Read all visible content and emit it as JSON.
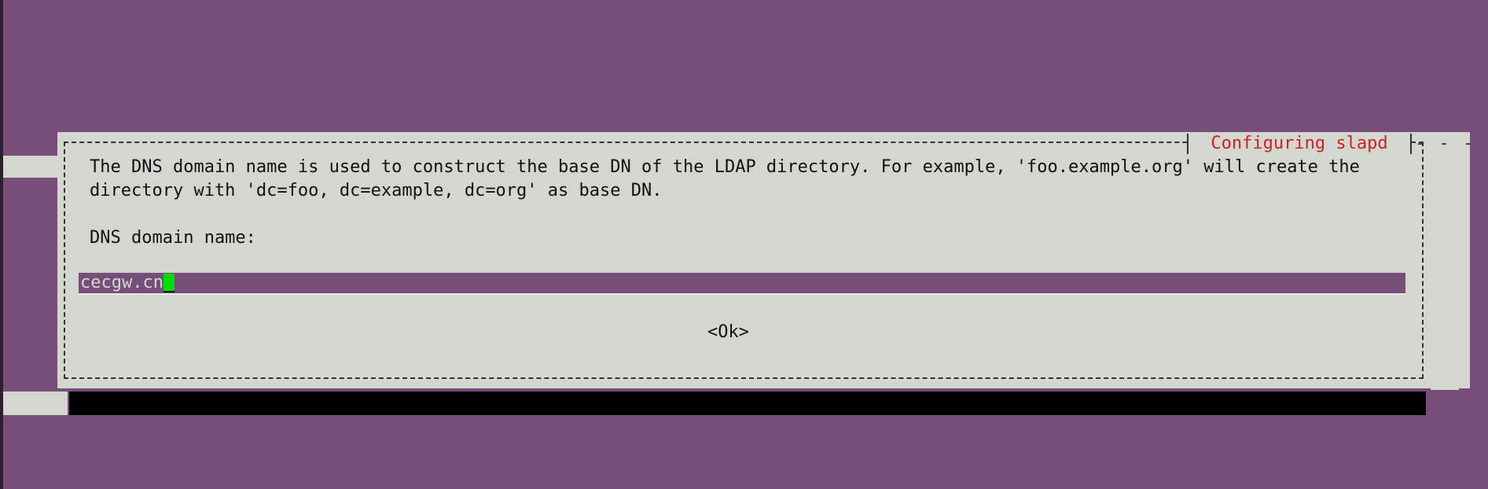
{
  "dialog": {
    "title": "Configuring slapd",
    "description": "The DNS domain name is used to construct the base DN of the LDAP directory. For example, 'foo.example.org' will create the directory with 'dc=foo, dc=example, dc=org' as base DN.",
    "field_label": "DNS domain name:",
    "input_value": "cecgw.cn",
    "ok_label": "<Ok>"
  },
  "colors": {
    "background": "#774d7a",
    "dialog": "#d3d7cf",
    "title": "#cc2222",
    "cursor": "#00e000",
    "shadow": "#000000"
  },
  "decor": {
    "bg_dash_top": "- - .",
    "bg_dash_bottom": "- - -",
    "right_dash": "- - -"
  }
}
